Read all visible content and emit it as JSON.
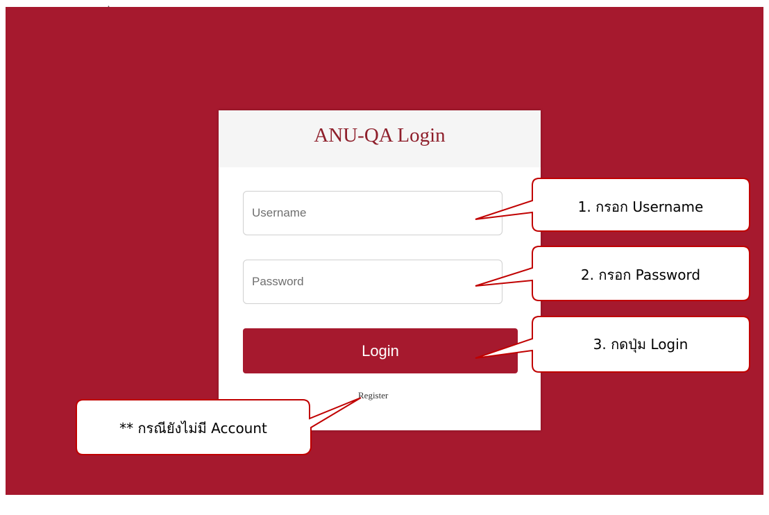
{
  "login": {
    "title": "ANU-QA Login",
    "username_placeholder": "Username",
    "password_placeholder": "Password",
    "login_label": "Login",
    "register_label": "Register"
  },
  "top_mark": "ุ",
  "annotations": {
    "step1": "1. กรอก Username",
    "step2": "2. กรอก Password",
    "step3": "3. กดปุ่ม Login",
    "note": "** กรณียังไม่มี Account"
  },
  "colors": {
    "background": "#a6192e",
    "button": "#a6192e",
    "title": "#8e1f2b",
    "callout_border": "#c00000"
  }
}
